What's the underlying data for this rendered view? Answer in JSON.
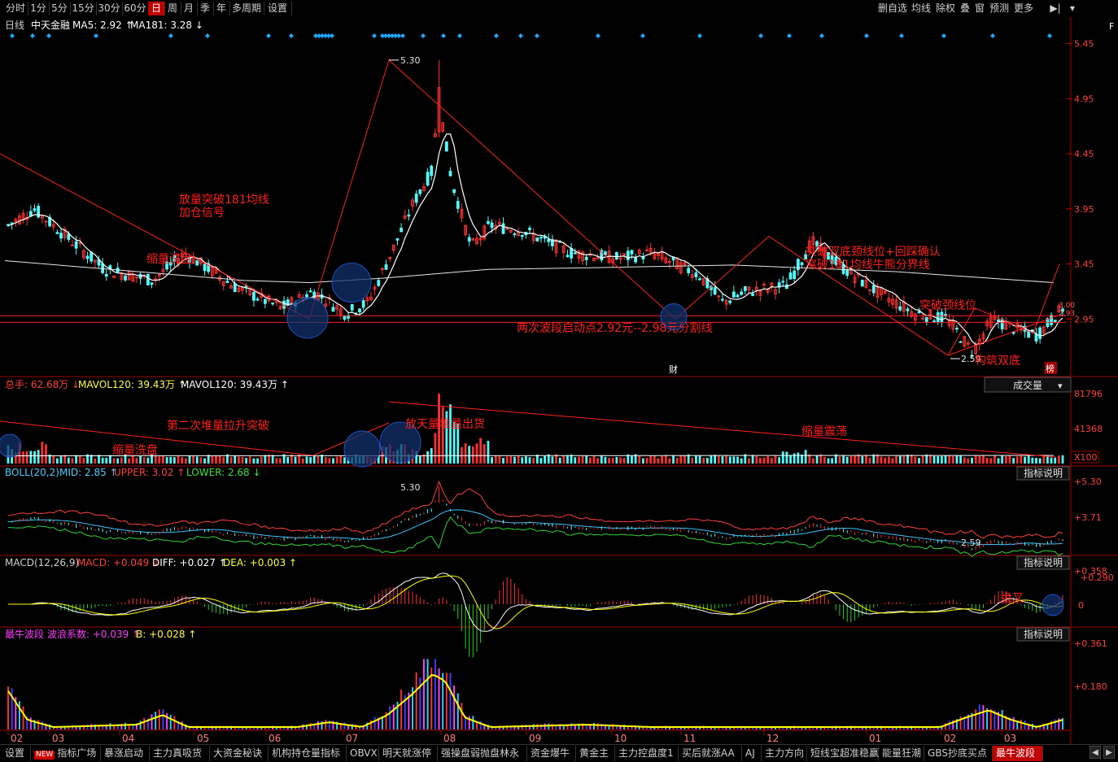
{
  "toolbar": {
    "periods": [
      "分时",
      "1分",
      "5分",
      "15分",
      "30分",
      "60分",
      "日",
      "周",
      "月",
      "季",
      "年",
      "多周期",
      "设置"
    ],
    "active_period": "日",
    "right_buttons": [
      "删自选",
      "均线",
      "除权",
      "叠",
      "窗",
      "预测",
      "更多"
    ]
  },
  "main_panel": {
    "info": {
      "period": "日线",
      "stock_name": "中天金融",
      "ma5": "MA5: 2.92",
      "ma181": "MA181: 3.28"
    },
    "price_labels": [
      "5.45",
      "4.95",
      "4.45",
      "3.95",
      "3.45",
      "2.95"
    ],
    "annotations": {
      "peak": "5.30",
      "low": "2.59",
      "a1_line1": "放量突破181均线",
      "a1_line2": "加仓信号",
      "a2": "缩量洗盘",
      "a3_line1": "突破双底颈线位+回踩确认",
      "a3_line2": "突破181均线牛熊分界线",
      "a4": "突破颈线位",
      "a5": "两次波段启动点2.92元--2.98元分割线",
      "a6": "构筑双底",
      "marker_cai": "财",
      "marker_bang": "榜",
      "tag_300": "3.00",
      "tag_293": "2.93"
    }
  },
  "volume_panel": {
    "info": {
      "total": "总手: 62.68万",
      "mavol1": "MAVOL120: 39.43万",
      "mavol2": "MAVOL120: 39.43万"
    },
    "dropdown": "成交量",
    "labels": [
      "81796",
      "41368",
      "X100"
    ],
    "annotations": {
      "v1": "第二次堆量拉升突破",
      "v2": "放天量堆量出货",
      "v3": "缩量震荡",
      "v4": "缩量洗盘"
    }
  },
  "boll_panel": {
    "info": {
      "name": "BOLL(20,2)",
      "mid": "MID: 2.85",
      "upper": "UPPER: 3.02",
      "lower": "LOWER: 2.68"
    },
    "button": "指标说明",
    "labels": [
      "+5.30",
      "+3.71"
    ],
    "peak": "5.30",
    "low": "2.59"
  },
  "macd_panel": {
    "info": {
      "name": "MACD(12,26,9)",
      "macd": "MACD: +0.049",
      "diff": "DIFF: +0.027",
      "dea": "DEA: +0.003"
    },
    "button": "指标说明",
    "labels": [
      "+0.358",
      "+0.290",
      "0"
    ],
    "annotation": "金叉"
  },
  "wave_panel": {
    "info": {
      "name": "最牛波段",
      "coef": "波浪系数: +0.039",
      "b": "B: +0.028"
    },
    "button": "指标说明",
    "labels": [
      "+0.361",
      "+0.180"
    ]
  },
  "months": [
    "02",
    "03",
    "04",
    "05",
    "06",
    "07",
    "08",
    "09",
    "10",
    "11",
    "12",
    "01",
    "02",
    "03"
  ],
  "bottom_tabs": {
    "new_badge": "NEW",
    "items": [
      "设置",
      "指标广场",
      "暴涨启动",
      "主力真吸货",
      "大资金秘诀",
      "机构持仓量指标",
      "OBVX",
      "明天就涨停",
      "强操盘弱抛盘林永",
      "资金爆牛",
      "黄金主",
      "主力控盘度1",
      "买后就涨AA",
      "AJ",
      "主力方向",
      "短线宝超准稳赢",
      "能量狂潮",
      "GBS抄底买点",
      "最牛波段"
    ],
    "active": "最牛波段"
  },
  "colors": {
    "up": "#ff3232",
    "down": "#54ffff",
    "ma_white": "#ffffff",
    "boll_mid": "#3fc3ff",
    "boll_lower": "#31d43a",
    "macd_dea": "#ffff00",
    "diamond": "#1fa8ff",
    "annotation": "#ff2020"
  },
  "chart_data": {
    "type": "candlestick",
    "symbol": "中天金融",
    "period": "日线",
    "price_range": [
      2.45,
      5.55
    ],
    "key_points": [
      {
        "month": "02",
        "price": 3.9
      },
      {
        "month": "03",
        "price": 3.48
      },
      {
        "month": "04",
        "price": 3.25
      },
      {
        "month": "05",
        "price": 3.05
      },
      {
        "month": "06",
        "price": 2.98
      },
      {
        "month": "07",
        "price": 5.3
      },
      {
        "month": "08",
        "price": 3.8
      },
      {
        "month": "09",
        "price": 3.55
      },
      {
        "month": "10",
        "price": 3.4
      },
      {
        "month": "11",
        "price": 2.95
      },
      {
        "month": "12",
        "price": 3.6
      },
      {
        "month": "01",
        "price": 2.9
      },
      {
        "month": "02",
        "price": 2.59
      },
      {
        "month": "03",
        "price": 3.0
      }
    ],
    "peak": 5.3,
    "low": 2.59,
    "ma181_end": 3.28,
    "ma5_end": 2.92,
    "volume_max": 81796,
    "volume_mid": 41368,
    "boll": {
      "mid": 2.85,
      "upper": 3.02,
      "lower": 2.68
    },
    "macd": {
      "macd": 0.049,
      "diff": 0.027,
      "dea": 0.003
    },
    "wave": {
      "coef": 0.039,
      "b": 0.028
    }
  }
}
